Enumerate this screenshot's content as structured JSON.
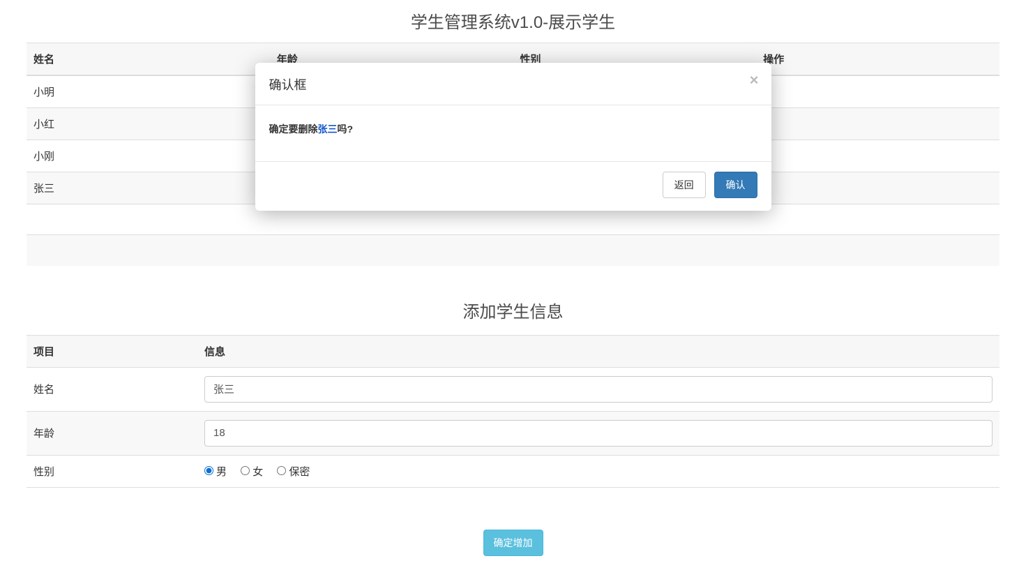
{
  "page_title": "学生管理系统v1.0-展示学生",
  "student_table": {
    "headers": {
      "name": "姓名",
      "age": "年龄",
      "gender": "性别",
      "action": "操作"
    },
    "rows": [
      {
        "name": "小明"
      },
      {
        "name": "小红"
      },
      {
        "name": "小刚"
      },
      {
        "name": "张三"
      }
    ]
  },
  "form": {
    "title": "添加学生信息",
    "headers": {
      "item": "项目",
      "info": "信息"
    },
    "labels": {
      "name": "姓名",
      "age": "年龄",
      "gender": "性别"
    },
    "values": {
      "name": "张三",
      "age": "18"
    },
    "gender_options": {
      "male": "男",
      "female": "女",
      "secret": "保密"
    },
    "gender_selected": "male",
    "submit_label": "确定增加"
  },
  "modal": {
    "title": "确认框",
    "confirm_prefix": "确定要删除",
    "confirm_target": "张三",
    "confirm_suffix": "吗?",
    "back_label": "返回",
    "confirm_label": "确认"
  }
}
